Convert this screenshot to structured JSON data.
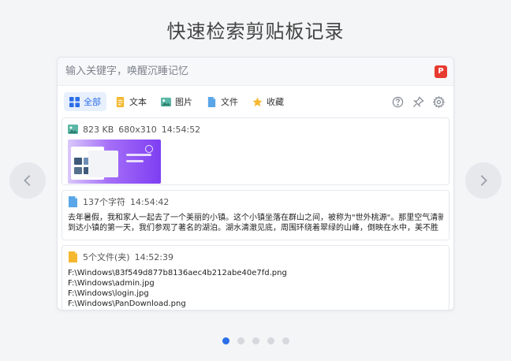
{
  "page": {
    "title": "快速检索剪贴板记录"
  },
  "search": {
    "placeholder": "输入关键字，唤醒沉睡记忆",
    "logo_text": "P"
  },
  "tabs": [
    {
      "label": "全部",
      "icon": "grid-icon",
      "active": true
    },
    {
      "label": "文本",
      "icon": "text-doc-icon"
    },
    {
      "label": "图片",
      "icon": "image-icon"
    },
    {
      "label": "文件",
      "icon": "file-icon"
    },
    {
      "label": "收藏",
      "icon": "star-icon"
    }
  ],
  "toolbar_icons": [
    "help-icon",
    "pin-icon",
    "settings-icon"
  ],
  "items": {
    "image": {
      "size": "823 KB",
      "dimensions": "680x310",
      "time": "14:54:52",
      "icon": "image-type-icon"
    },
    "text": {
      "count": "137个字符",
      "time": "14:54:42",
      "line1": "去年暑假，我和家人一起去了一个美丽的小镇。这个小镇坐落在群山之间，被称为\"世外桃源\"。那里空气清新",
      "line2": "到达小镇的第一天，我们参观了著名的湖泊。湖水清澈见底，周围环绕着翠绿的山峰，倒映在水中，美不胜",
      "icon": "text-type-icon"
    },
    "files": {
      "count": "5个文件(夹)",
      "time": "14:52:39",
      "paths": [
        "F:\\Windows\\83f549d877b8136aec4b212abe40e7fd.png",
        "F:\\Windows\\admin.jpg",
        "F:\\Windows\\login.jpg",
        "F:\\Windows\\PanDownload.png"
      ],
      "icon": "folder-type-icon"
    }
  },
  "colors": {
    "accent": "#2a6ee8",
    "thumb_purple": "#7e3ef2",
    "logo_red": "#e63b2e"
  },
  "pagination": {
    "total": 5,
    "active_index": 0
  }
}
